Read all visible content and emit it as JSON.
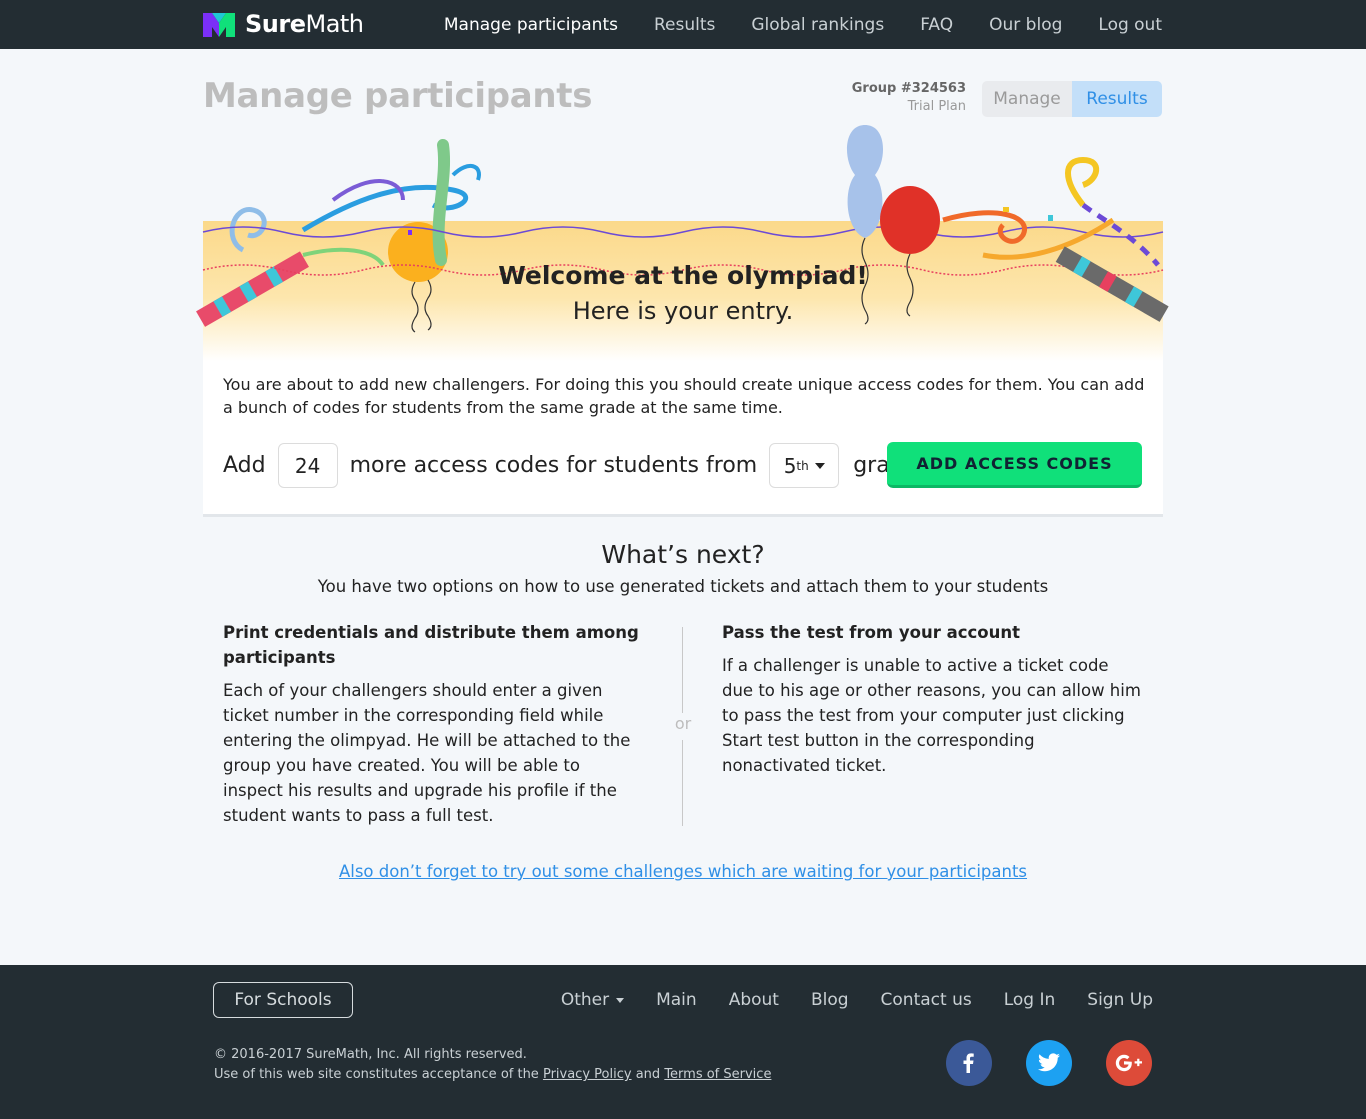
{
  "nav": {
    "brand_bold": "Sure",
    "brand_regular": "Math",
    "links": [
      "Manage participants",
      "Results",
      "Global rankings",
      "FAQ",
      "Our blog",
      "Log out"
    ],
    "active": "Manage participants"
  },
  "header": {
    "title": "Manage participants",
    "group_id": "Group #324563",
    "plan": "Trial Plan",
    "segment": [
      "Manage",
      "Results"
    ],
    "selected_segment": "Results"
  },
  "banner": {
    "welcome": "Welcome at the olympiad!",
    "entry": "Here is your entry."
  },
  "card": {
    "description": "You are about to add new challengers. For doing this you should create unique access codes for them. You can add a bunch of codes for students from the same grade at the same time.",
    "add_word": "Add",
    "quantity": "24",
    "middle_text": "more access codes for students from",
    "grade_value": "5",
    "grade_suffix": "th",
    "grade_word": "grade",
    "add_button": "ADD ACCESS CODES"
  },
  "next": {
    "title": "What’s next?",
    "subtitle": "You have two options on how to use generated tickets and attach them to your students",
    "left_title": "Print credentials and distribute them among participants",
    "left_body": "Each of your challengers should enter a given ticket number in the corresponding field while entering the olimpyad. He will be attached to the group you have created. You will be able to inspect his results and upgrade his profile if the student wants to pass a full test.",
    "or": "or",
    "right_title": "Pass the test from your account",
    "right_body": "If a challenger is unable to active a ticket code due to his age or other reasons, you can allow him to pass the test from your computer just clicking Start test button in the corresponding nonactivated ticket.",
    "link": "Also don’t forget to try out some challenges which are waiting for your participants"
  },
  "footer": {
    "for_schools": "For Schools",
    "links": [
      "Other",
      "Main",
      "About",
      "Blog",
      "Contact us",
      "Log In",
      "Sign Up"
    ],
    "copyright": "© 2016-2017 SureMath, Inc. All rights reserved.",
    "terms_prefix": "Use of this web site constitutes acceptance of the",
    "privacy": "Privacy Policy",
    "and": "and",
    "terms": "Terms of Service",
    "social": [
      "facebook-icon",
      "twitter-icon",
      "google-plus-icon"
    ]
  },
  "colors": {
    "nav_bg": "#232d33",
    "accent_blue": "#2f8fe6",
    "add_button": "#10e07a",
    "banner_yellow": "#fbd98a"
  }
}
